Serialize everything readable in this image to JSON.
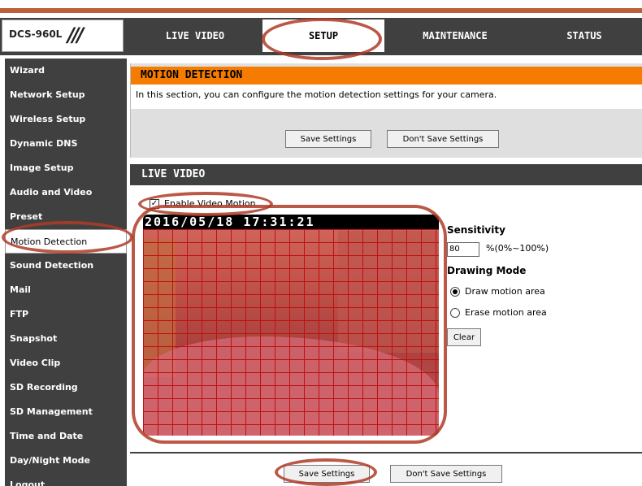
{
  "header": {
    "logo": "DCS-960L",
    "tabs": [
      "LIVE VIDEO",
      "SETUP",
      "MAINTENANCE",
      "STATUS"
    ]
  },
  "sidebar": {
    "items": [
      {
        "label": "Wizard"
      },
      {
        "label": "Network Setup"
      },
      {
        "label": "Wireless Setup"
      },
      {
        "label": "Dynamic DNS"
      },
      {
        "label": "Image Setup"
      },
      {
        "label": "Audio and Video"
      },
      {
        "label": "Preset"
      },
      {
        "label": "Motion Detection",
        "active": true
      },
      {
        "label": "Sound Detection"
      },
      {
        "label": "Mail"
      },
      {
        "label": "FTP"
      },
      {
        "label": "Snapshot"
      },
      {
        "label": "Video Clip"
      },
      {
        "label": "SD Recording"
      },
      {
        "label": "SD Management"
      },
      {
        "label": "Time and Date"
      },
      {
        "label": "Day/Night Mode"
      },
      {
        "label": "Logout"
      }
    ]
  },
  "motion": {
    "title": "MOTION DETECTION",
    "description": "In this section, you can configure the motion detection settings for your camera.",
    "save_label": "Save Settings",
    "dont_save_label": "Don't Save Settings"
  },
  "live": {
    "title": "LIVE VIDEO",
    "enable_label": "Enable Video Motion",
    "enable_checked": "✓",
    "timestamp": "2016/05/18  17:31:21",
    "sensitivity_label": "Sensitivity",
    "sensitivity_value": "80",
    "sensitivity_unit": "%(0%~100%)",
    "drawing_mode_label": "Drawing Mode",
    "draw_option": "Draw motion area",
    "erase_option": "Erase motion area",
    "clear_label": "Clear"
  },
  "footer": {
    "save_label": "Save Settings",
    "dont_save_label": "Don't Save Settings"
  },
  "colors": {
    "orange_header": "#f57c00",
    "dark_bar": "#404040",
    "highlight_ring": "#af3c28"
  }
}
